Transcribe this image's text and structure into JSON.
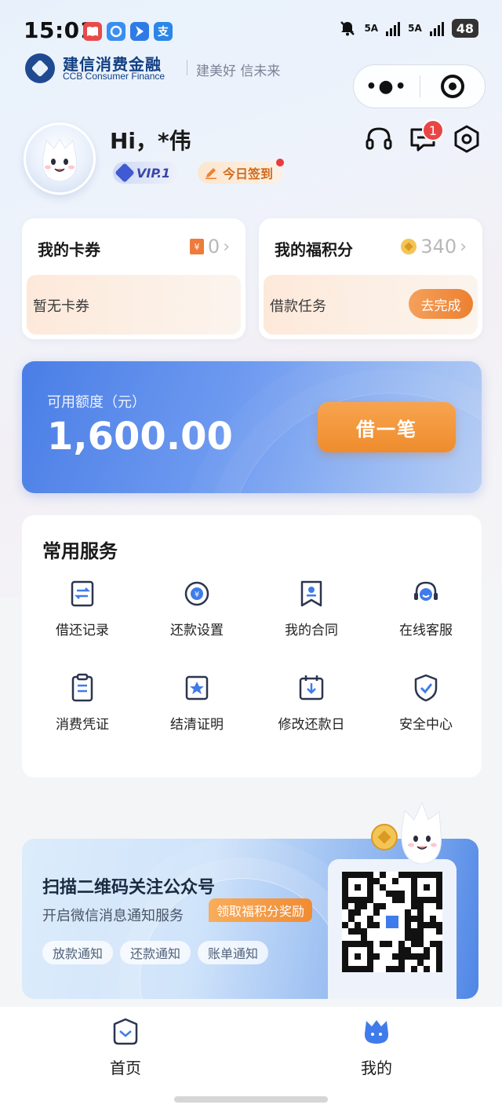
{
  "status_bar": {
    "time": "15:01",
    "apps": [
      {
        "icon": "book-app-icon",
        "color": "#e84a4a"
      },
      {
        "icon": "browser-app-icon",
        "color": "#3a8ef0"
      },
      {
        "icon": "navigation-app-icon",
        "color": "#2f7be6"
      },
      {
        "icon": "alipay-app-icon",
        "color": "#2a86e8",
        "glyph": "支"
      }
    ],
    "sim1": "5A",
    "sim2": "5A",
    "battery": "48"
  },
  "brand": {
    "name_cn": "建信消费金融",
    "name_en": "CCB Consumer Finance",
    "slogan": "建美好 信未来"
  },
  "profile": {
    "greeting": "Hi，*伟",
    "vip_level": "VIP.1",
    "checkin_label": "今日签到",
    "message_badge": "1"
  },
  "cards": {
    "coupons": {
      "title": "我的卡券",
      "count": "0",
      "empty_text": "暂无卡券"
    },
    "points": {
      "title": "我的福积分",
      "count": "340",
      "task_text": "借款任务",
      "task_button": "去完成"
    }
  },
  "credit": {
    "label": "可用额度（元）",
    "amount": "1,600.00",
    "borrow_button": "借一笔"
  },
  "services": {
    "title": "常用服务",
    "items": [
      {
        "label": "借还记录",
        "icon": "record-icon"
      },
      {
        "label": "还款设置",
        "icon": "repayment-settings-icon"
      },
      {
        "label": "我的合同",
        "icon": "contract-icon"
      },
      {
        "label": "在线客服",
        "icon": "customer-service-icon"
      },
      {
        "label": "消费凭证",
        "icon": "voucher-icon"
      },
      {
        "label": "结清证明",
        "icon": "settlement-certificate-icon"
      },
      {
        "label": "修改还款日",
        "icon": "change-due-date-icon"
      },
      {
        "label": "安全中心",
        "icon": "security-center-icon"
      }
    ]
  },
  "qr_banner": {
    "title": "扫描二维码关注公众号",
    "subtitle": "开启微信消息通知服务",
    "reward": "领取福积分奖励",
    "tags": [
      "放款通知",
      "还款通知",
      "账单通知"
    ]
  },
  "tabbar": {
    "home": "首页",
    "mine": "我的"
  },
  "colors": {
    "accent_orange": "#ef8c2d",
    "brand_blue": "#123f83",
    "credit_blue": "#4a7ee6",
    "badge_red": "#ea4545"
  }
}
